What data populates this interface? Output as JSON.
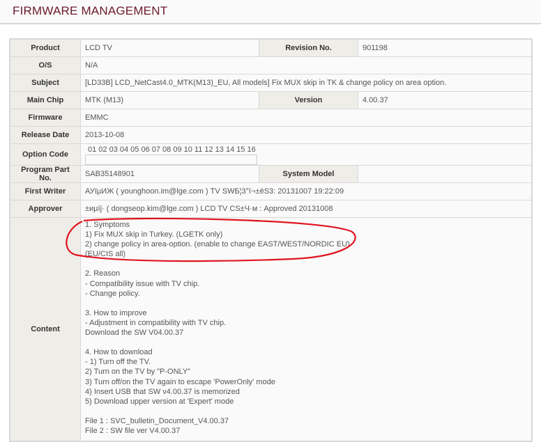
{
  "page_title": "FIRMWARE MANAGEMENT",
  "fields": {
    "product": {
      "label": "Product",
      "value": "LCD TV"
    },
    "revision": {
      "label": "Revision No.",
      "value": "901198"
    },
    "os": {
      "label": "O/S",
      "value": "N/A"
    },
    "subject": {
      "label": "Subject",
      "value": "[LD33B] LCD_NetCast4.0_MTK(M13)_EU, All models] Fix MUX skip in TK & change policy on area option."
    },
    "main_chip": {
      "label": "Main Chip",
      "value": "MTK (M13)"
    },
    "version": {
      "label": "Version",
      "value": "4.00.37"
    },
    "firmware": {
      "label": "Firmware",
      "value": "EMMC"
    },
    "release_date": {
      "label": "Release Date",
      "value": "2013-10-08"
    },
    "option_code": {
      "label": "Option Code",
      "value": "01 02 03 04 05 06 07 08 09 10 11 12 13 14 15 16",
      "input_value": ""
    },
    "program_part": {
      "label": "Program Part No.",
      "value": "SAB35148901"
    },
    "system_model": {
      "label": "System Model",
      "value": ""
    },
    "first_writer": {
      "label": "First Writer",
      "value": "АУïµИЖ ( younghoon.im@lge.com ) TV SWБ¦3°ï¬±ëS3: 20131007 19:22:09"
    },
    "approver": {
      "label": "Approver",
      "value": "±иµïј· ( dongseop.kim@lge.com ) LCD TV CS±Ч·м : Approved 20131008"
    },
    "content": {
      "label": "Content",
      "lines": [
        "1. Symptoms",
        "1) Fix MUX skip in Turkey. (LGETK only)",
        "2) change policy in area-option. (enable to change EAST/WEST/NORDIC EU)",
        "(EU/CIS all)",
        "",
        "2. Reason",
        "- Compatibility issue with TV chip.",
        "- Change policy.",
        "",
        "3. How to improve",
        "- Adjustment in compatibility with TV chip.",
        "Download the SW V04.00.37",
        "",
        "4. How to download",
        "- 1) Turn off the TV.",
        "2) Turn on the TV by \"P-ONLY\"",
        "3) Turn off/on the TV again to escape 'PowerOnly' mode",
        "4) Insert USB that SW v4.00.37 is memorized",
        "5) Download upper version at 'Expert' mode",
        "",
        "File 1 : SVC_bulletin_Document_V4.00.37",
        "File 2 : SW file ver V4.00.37"
      ]
    }
  },
  "colors": {
    "title": "#6b1a2c",
    "annotation": "#e0141e"
  }
}
